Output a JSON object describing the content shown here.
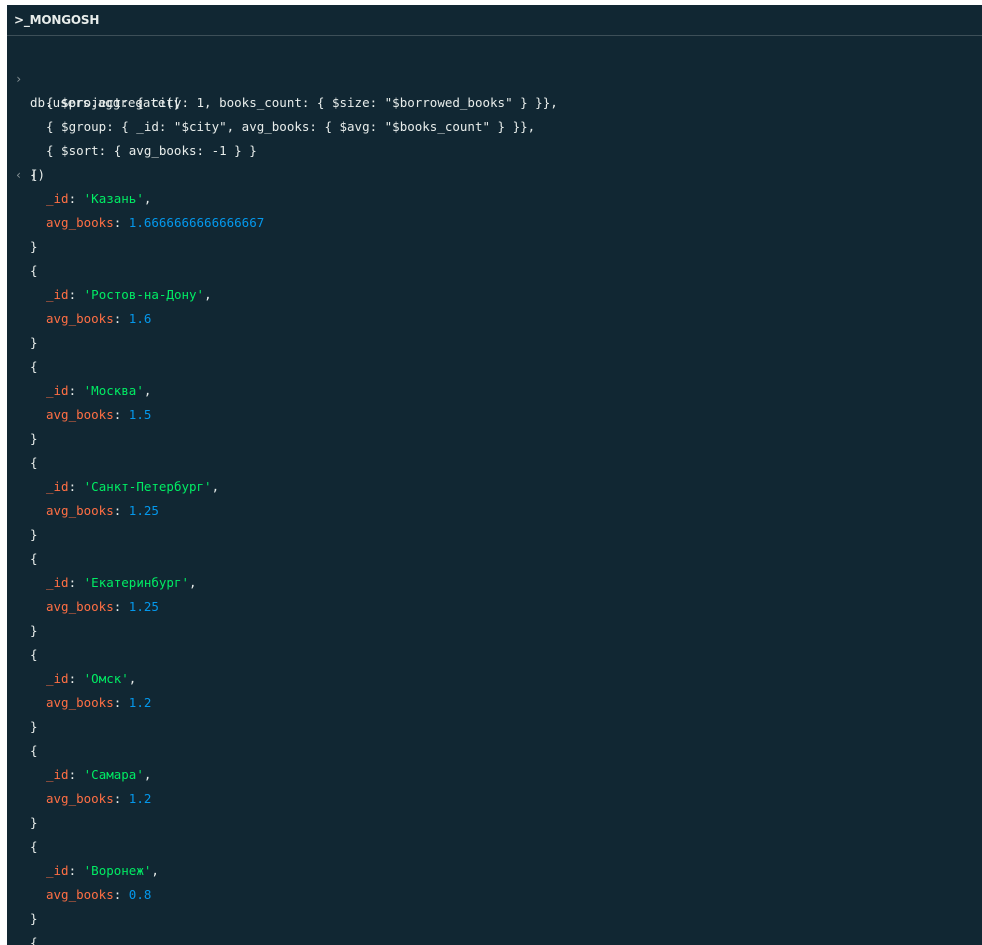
{
  "title": ">_MONGOSH",
  "prompt_glyph": "›",
  "result_glyph": "‹",
  "input": {
    "line1": "db.users.aggregate([",
    "line2": "{ $project: { city: 1, books_count: { $size: \"$borrowed_books\" } }},",
    "line3": "{ $group: { _id: \"$city\", avg_books: { $avg: \"$books_count\" } }},",
    "line4": "{ $sort: { avg_books: -1 } }",
    "line5": "])"
  },
  "keys": {
    "id": "_id",
    "avg": "avg_books"
  },
  "results": [
    {
      "id": "'Казань'",
      "avg": "1.6666666666666667"
    },
    {
      "id": "'Ростов-на-Дону'",
      "avg": "1.6"
    },
    {
      "id": "'Москва'",
      "avg": "1.5"
    },
    {
      "id": "'Санкт-Петербург'",
      "avg": "1.25"
    },
    {
      "id": "'Екатеринбург'",
      "avg": "1.25"
    },
    {
      "id": "'Омск'",
      "avg": "1.2"
    },
    {
      "id": "'Самара'",
      "avg": "1.2"
    },
    {
      "id": "'Воронеж'",
      "avg": "0.8"
    }
  ]
}
